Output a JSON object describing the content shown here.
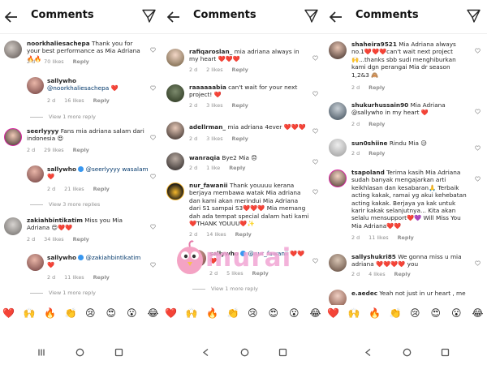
{
  "header": {
    "title": "Comments"
  },
  "panels": [
    {
      "comments": [
        {
          "user": "noorkhaliesachepa",
          "text": "Thank you for your best performance as Mia Adriana 🔥🔥",
          "time": "2 d",
          "likes": "70 likes",
          "reply": "Reply"
        },
        {
          "user": "sallywho",
          "text": "@noorkhaliesachepa ❤️",
          "time": "2 d",
          "likes": "16 likes",
          "reply": "Reply"
        },
        {
          "user": "seerlyyyy",
          "text": "Fans mia adriana salam dari indonesia 😍",
          "time": "2 d",
          "likes": "29 likes",
          "reply": "Reply"
        },
        {
          "user": "sallywho",
          "text": "@seerlyyyy wasalam ❤️",
          "time": "2 d",
          "likes": "21 likes",
          "reply": "Reply"
        },
        {
          "user": "zakiahbintikatim",
          "text": "Miss you Mia Adriana 😍❤️❤️",
          "time": "2 d",
          "likes": "34 likes",
          "reply": "Reply"
        },
        {
          "user": "sallywho",
          "text": "@zakiahbintikatim ❤️",
          "time": "2 d",
          "likes": "11 likes",
          "reply": "Reply"
        }
      ],
      "view_replies": [
        "View 1 more reply",
        "View 3 more replies",
        "View 1 more reply"
      ]
    },
    {
      "comments": [
        {
          "user": "rafiqaroslan_",
          "text": "mia adriana always in my heart ❤️❤️❤️",
          "time": "2 d",
          "likes": "2 likes",
          "reply": "Reply"
        },
        {
          "user": "raaaaaabia",
          "text": "can't wait for your next project! ❤️",
          "time": "2 d",
          "likes": "3 likes",
          "reply": "Reply"
        },
        {
          "user": "adellrman_",
          "text": "mia adriana 4ever ❤️❤️❤️",
          "time": "2 d",
          "likes": "3 likes",
          "reply": "Reply"
        },
        {
          "user": "wanraqia",
          "text": "Bye2 Mia 😞",
          "time": "2 d",
          "likes": "1 like",
          "reply": "Reply"
        },
        {
          "user": "nur_fawanii",
          "text": "Thank youuuu kerana berjaya membawa watak Mia adriana dan kami akan merindui Mia Adriana dari S1 sampai S3❤️❤️❤️ Mia memang dah ada tempat special dalam hati kami❤️THANK YOUUU❤️✨",
          "time": "2 d",
          "likes": "14 likes",
          "reply": "Reply"
        },
        {
          "user": "sallywho",
          "text": "@nur_fawanii ❤️❤️ ❤️",
          "time": "2 d",
          "likes": "5 likes",
          "reply": "Reply"
        }
      ],
      "view_replies": [
        "View 1 more reply"
      ]
    },
    {
      "comments": [
        {
          "user": "shaheira9521",
          "text": "Mia Adriana always no.1❤️❤️❤️can't wait next project 🙌...thanks sbb sudi menghiburkan kami dgn perangai Mia dr season 1,2&3 🙈",
          "time": "2 d",
          "likes": "",
          "reply": "Reply"
        },
        {
          "user": "shukurhussain90",
          "text": "Mia Adriana @sallywho in my heart ❤️",
          "time": "2 d",
          "likes": "",
          "reply": "Reply"
        },
        {
          "user": "sun0shiine",
          "text": "Rindu Mia 😥",
          "time": "2 d",
          "likes": "",
          "reply": "Reply"
        },
        {
          "user": "tsapoland",
          "text": "Terima kasih Mia Adriana sudah banyak mengajarkan arti keikhlasan dan kesabaran🙏 Terbaik acting kakak, ramai yg akui kehebatan acting kakak. Berjaya ya kak untuk karir kakak selanjutnya... Kita akan selalu mensupport❤️💜 Will Miss You Mia Adriana❤️❤️",
          "time": "2 d",
          "likes": "11 likes",
          "reply": "Reply"
        },
        {
          "user": "sallyshukri85",
          "text": "We gonna miss u mia adriana ❤️❤️❤️❤️ you",
          "time": "2 d",
          "likes": "4 likes",
          "reply": "Reply"
        },
        {
          "user": "e.aedec",
          "text": "Yeah not just in ur heart , me",
          "time": "",
          "likes": "",
          "reply": ""
        }
      ]
    }
  ],
  "emoji_bar": [
    "❤️",
    "🙌",
    "🔥",
    "👏",
    "😢",
    "😍",
    "😮",
    "😂",
    "❤️",
    "🙌",
    "🔥",
    "👏",
    "😢",
    "😍",
    "😮",
    "😂",
    "❤️",
    "🙌",
    "🔥",
    "👏",
    "😢",
    "😍",
    "😮",
    "😂"
  ],
  "watermark": {
    "text": "murai"
  },
  "colors": {
    "mention": "#00376b",
    "meta": "#8e8e8e",
    "verified": "#3897f0",
    "heart": "#ed4956"
  }
}
